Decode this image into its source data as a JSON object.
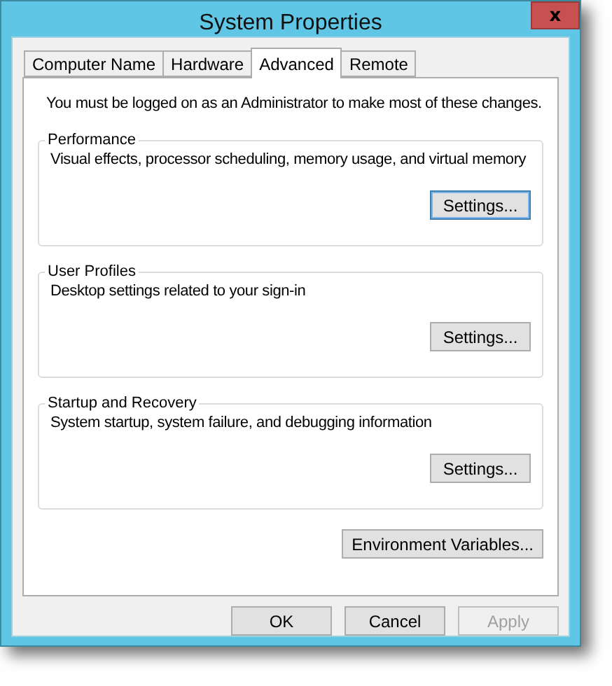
{
  "window": {
    "title": "System Properties",
    "close": "x"
  },
  "tabs": [
    {
      "label": "Computer Name",
      "selected": false
    },
    {
      "label": "Hardware",
      "selected": false
    },
    {
      "label": "Advanced",
      "selected": true
    },
    {
      "label": "Remote",
      "selected": false
    }
  ],
  "notice": "You must be logged on as an Administrator to make most of these changes.",
  "groups": [
    {
      "title": "Performance",
      "description": "Visual effects, processor scheduling, memory usage, and virtual memory",
      "button": "Settings...",
      "focused": true
    },
    {
      "title": "User Profiles",
      "description": "Desktop settings related to your sign-in",
      "button": "Settings...",
      "focused": false
    },
    {
      "title": "Startup and Recovery",
      "description": "System startup, system failure, and debugging information",
      "button": "Settings...",
      "focused": false
    }
  ],
  "environment_button": "Environment Variables...",
  "buttons": [
    {
      "label": "OK",
      "disabled": false
    },
    {
      "label": "Cancel",
      "disabled": false
    },
    {
      "label": "Apply",
      "disabled": true
    }
  ]
}
